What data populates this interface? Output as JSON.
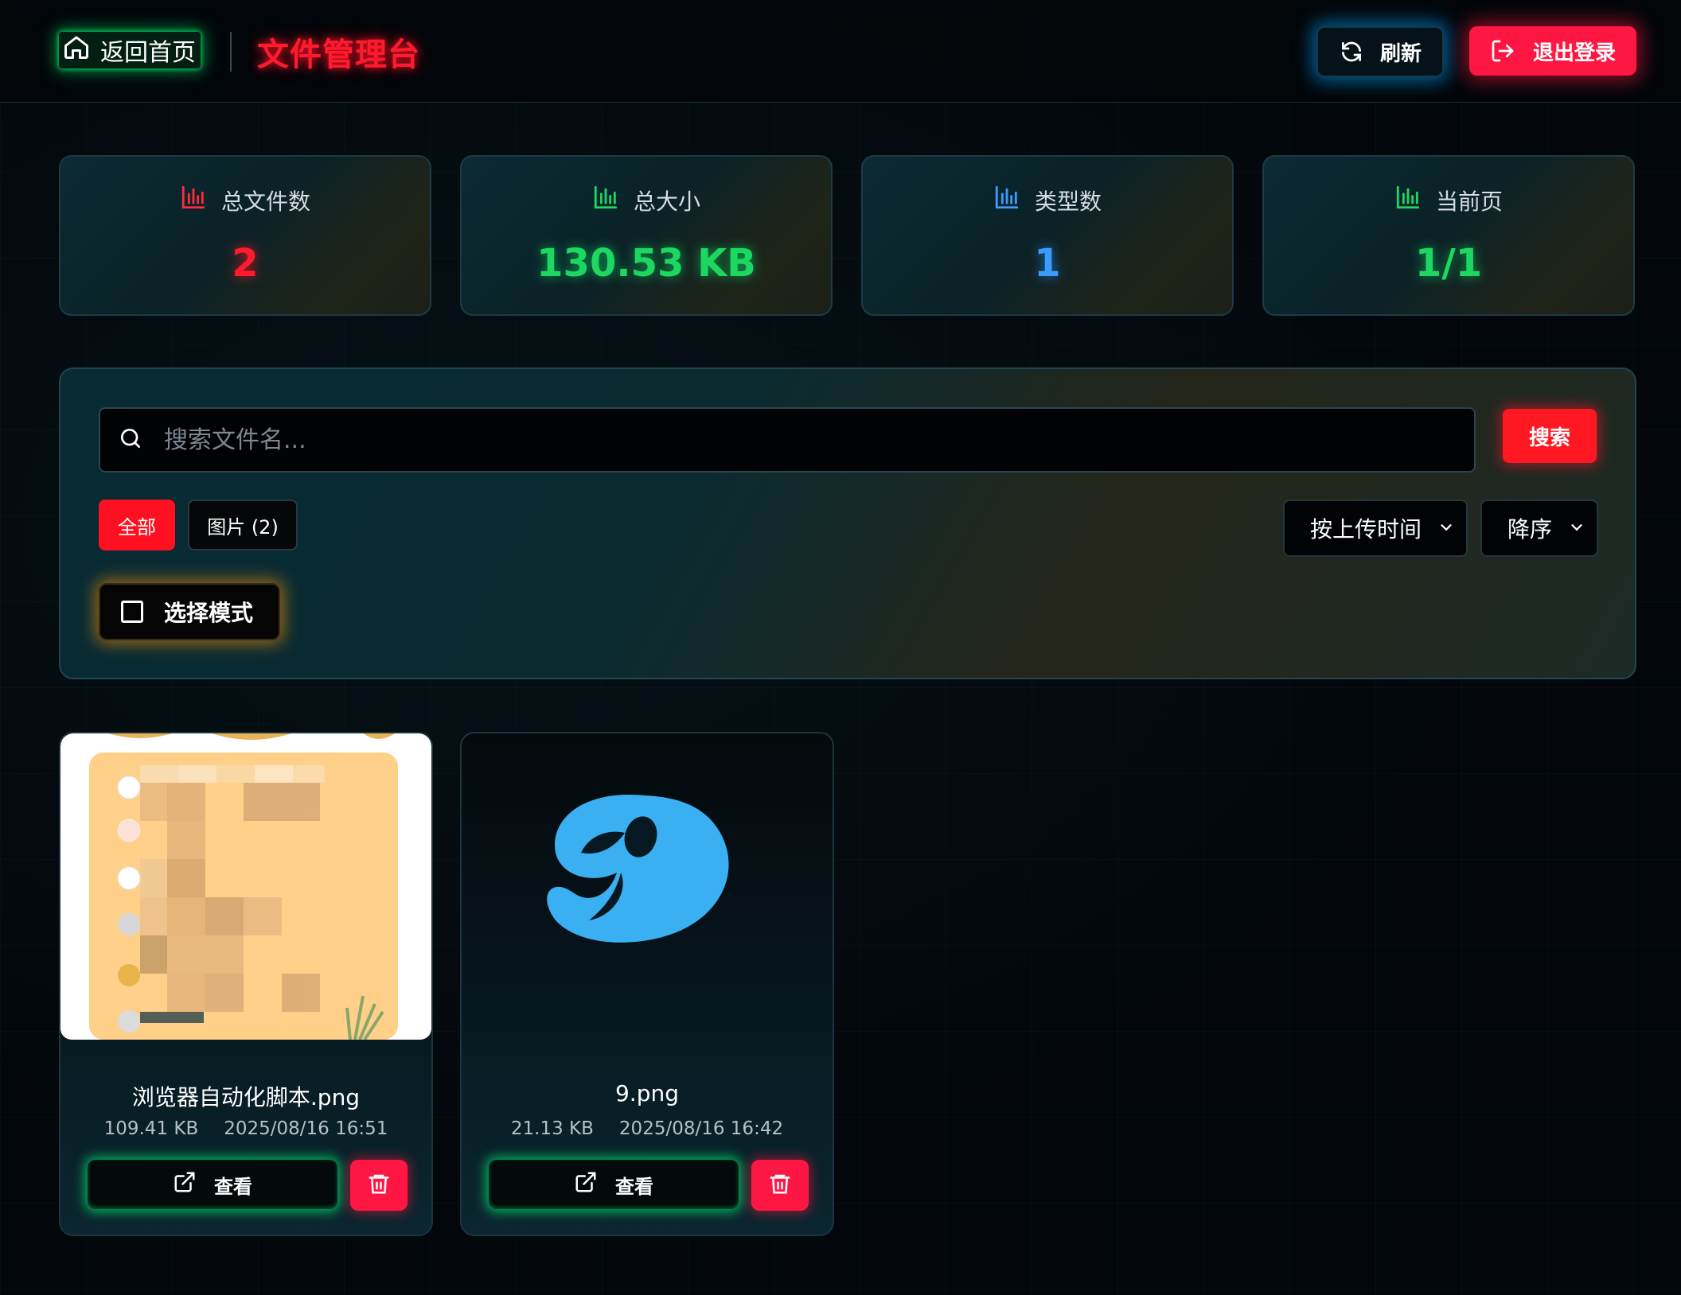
{
  "header": {
    "home_label": "返回首页",
    "title": "文件管理台",
    "refresh_label": "刷新",
    "logout_label": "退出登录"
  },
  "stats": [
    {
      "label": "总文件数",
      "value": "2",
      "color": "#ff1a2e"
    },
    {
      "label": "总大小",
      "value": "130.53 KB",
      "color": "#1ed760"
    },
    {
      "label": "类型数",
      "value": "1",
      "color": "#3b9cff"
    },
    {
      "label": "当前页",
      "value": "1/1",
      "color": "#1ed760"
    }
  ],
  "filters": {
    "search_placeholder": "搜索文件名...",
    "search_button": "搜索",
    "chips": [
      {
        "label": "全部",
        "active": true
      },
      {
        "label": "图片 (2)",
        "active": false
      }
    ],
    "sort_by": "按上传时间",
    "sort_order": "降序",
    "select_mode_label": "选择模式"
  },
  "files": [
    {
      "name": "浏览器自动化脚本.png",
      "size": "109.41 KB",
      "date": "2025/08/16 16:51",
      "view_label": "查看"
    },
    {
      "name": "9.png",
      "size": "21.13 KB",
      "date": "2025/08/16 16:42",
      "view_label": "查看"
    }
  ],
  "colors": {
    "accent_red": "#ff1744",
    "accent_green": "#1ed760",
    "accent_blue": "#3b9cff",
    "accent_orange": "#ff9800"
  }
}
